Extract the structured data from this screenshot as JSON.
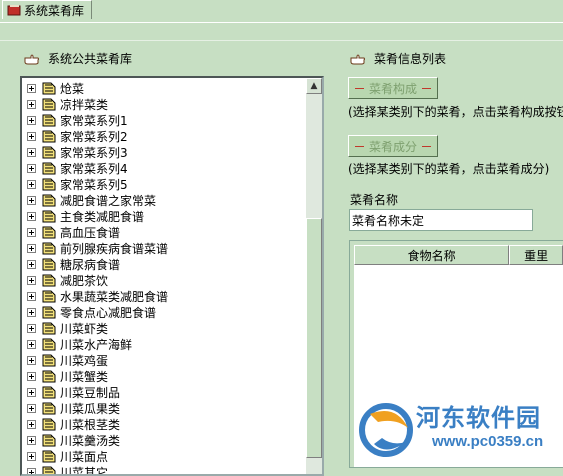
{
  "tab": {
    "label": "系统菜肴库",
    "icon": "book-icon"
  },
  "left_panel": {
    "title": "系统公共菜肴库",
    "tree_items": [
      "炝菜",
      "凉拌菜类",
      "家常菜系列1",
      "家常菜系列2",
      "家常菜系列3",
      "家常菜系列4",
      "家常菜系列5",
      "减肥食谱之家常菜",
      "主食类减肥食谱",
      "高血压食谱",
      "前列腺疾病食谱菜谱",
      "糖尿病食谱",
      "减肥茶饮",
      "水果蔬菜类减肥食谱",
      "零食点心减肥食谱",
      "川菜虾类",
      "川菜水产海鲜",
      "川菜鸡蛋",
      "川菜蟹类",
      "川菜豆制品",
      "川菜瓜果类",
      "川菜根茎类",
      "川菜羹汤类",
      "川菜面点",
      "川菜其它"
    ]
  },
  "right_panel": {
    "title": "菜肴信息列表",
    "composition_button": "菜肴构成",
    "composition_hint": "(选择某类别下的菜肴，点击菜肴构成按钮",
    "ingredients_button": "菜肴成分",
    "ingredients_hint": "(选择某类别下的菜肴，点击菜肴成分)",
    "name_label": "菜肴名称",
    "name_value": "菜肴名称未定",
    "grid_headers": [
      "食物名称",
      "重里"
    ]
  },
  "watermark": {
    "text": "河东软件园",
    "url": "www.pc0359.cn"
  },
  "colors": {
    "background": "#c7dfc3",
    "watermark": "#3a7fc4"
  }
}
